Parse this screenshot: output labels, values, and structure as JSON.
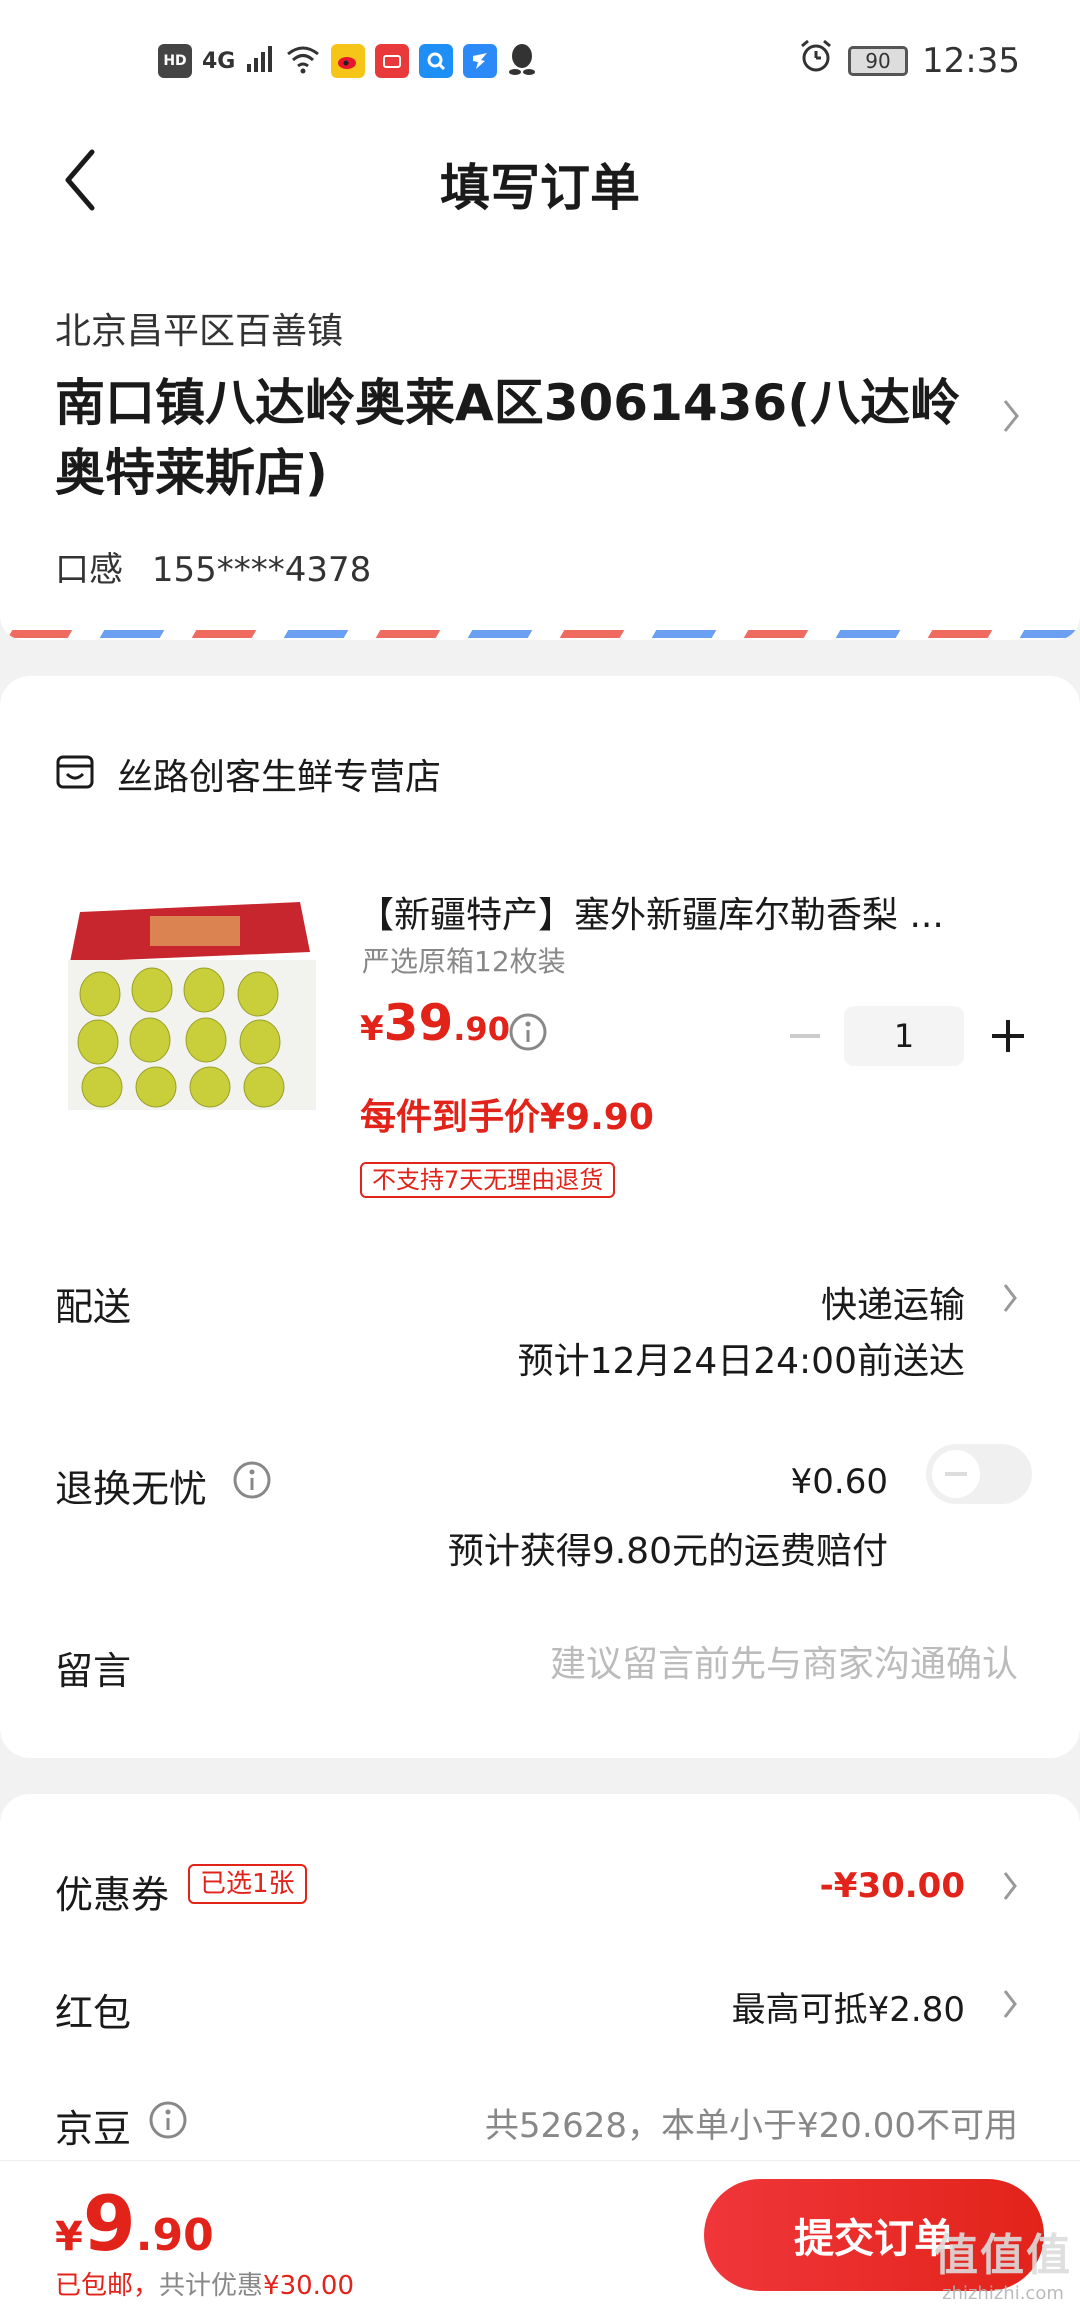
{
  "status_bar": {
    "hd": "HD",
    "signal": "4G",
    "battery": "90",
    "time": "12:35"
  },
  "nav": {
    "title": "填写订单"
  },
  "address": {
    "region": "北京昌平区百善镇",
    "detail": "南口镇八达岭奥莱A区3061436(八达岭奥特莱斯店)",
    "name": "口感",
    "phone": "155****4378"
  },
  "store": {
    "name": "丝路创客生鲜专营店"
  },
  "product": {
    "title": "【新疆特产】塞外新疆库尔勒香梨 ...",
    "spec": "严选原箱12枚装",
    "price_currency": "¥",
    "price_int": "39",
    "price_dec": ".90",
    "quantity": "1",
    "unit_price": "每件到手价¥9.90",
    "tag": "不支持7天无理由退货"
  },
  "delivery": {
    "label": "配送",
    "method": "快递运输",
    "eta": "预计12月24日24:00前送达"
  },
  "insurance": {
    "label": "退换无忧",
    "price": "¥0.60",
    "note": "预计获得9.80元的运费赔付",
    "enabled": false
  },
  "message": {
    "label": "留言",
    "placeholder": "建议留言前先与商家沟通确认"
  },
  "discounts": {
    "coupon_label": "优惠券",
    "coupon_tag": "已选1张",
    "coupon_value": "-¥30.00",
    "redpack_label": "红包",
    "redpack_value": "最高可抵¥2.80",
    "jd_label": "京豆",
    "jd_value": "共52628，本单小于¥20.00不可用"
  },
  "footer": {
    "total_currency": "¥",
    "total_int": "9",
    "total_dec": ".90",
    "note_shipping": "已包邮，",
    "note_total": "共计优惠",
    "note_amount": "¥30.00",
    "submit_label": "提交订单",
    "watermark": "值值值",
    "watermark_url": "zhizhizhi.com"
  },
  "colors": {
    "accent": "#e2231a",
    "background": "#f2f2f2",
    "airmail_red": "#ef6b5f",
    "airmail_blue": "#6b9ff2"
  }
}
